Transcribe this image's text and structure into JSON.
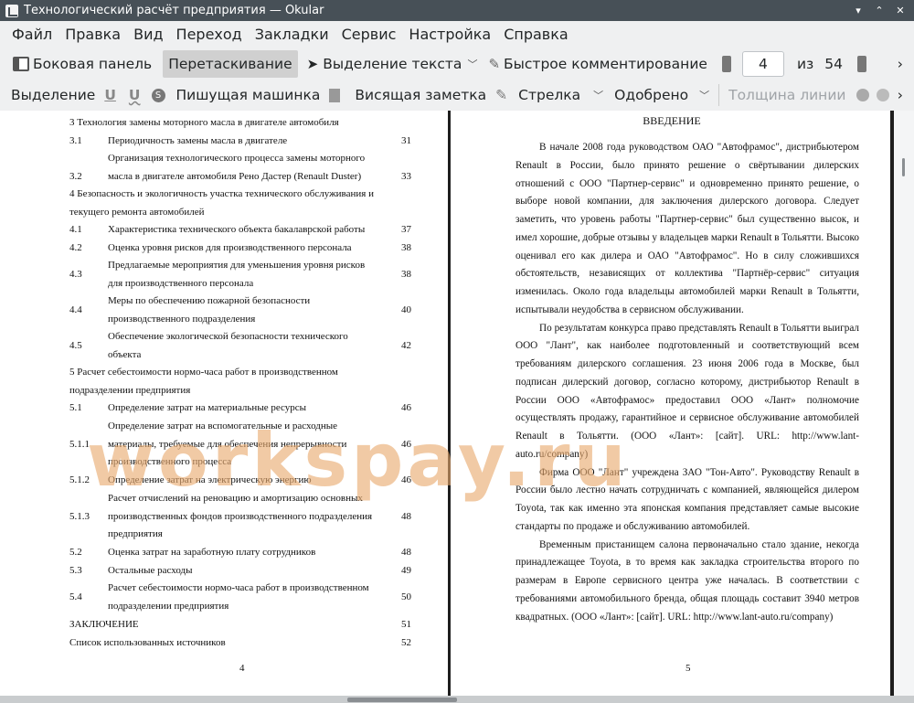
{
  "window": {
    "title": "Технологический расчёт предприятия  — Okular",
    "controls": [
      "▾",
      "⌃",
      "✕"
    ]
  },
  "menu": [
    "Файл",
    "Правка",
    "Вид",
    "Переход",
    "Закладки",
    "Сервис",
    "Настройка",
    "Справка"
  ],
  "toolbar1": {
    "sidebar": "Боковая панель",
    "drag": "Перетаскивание",
    "select_text": "Выделение текста",
    "quick_comment": "Быстрое комментирование",
    "page_current": "4",
    "page_of": "из",
    "page_total": "54",
    "more": "›"
  },
  "toolbar2": {
    "selection": "Выделение",
    "typewriter": "Пишущая машинка",
    "hanging_note": "Висящая заметка",
    "arrow": "Стрелка",
    "approved": "Одобрено",
    "line_width": "Толщина линии",
    "more": "›"
  },
  "left_page": {
    "page_number": "4",
    "entries": [
      {
        "n": "",
        "title": "3 Технология замены моторного масла в двигателе автомобиля",
        "p": ""
      },
      {
        "n": "3.1",
        "title": "Периодичность замены масла в двигателе",
        "p": "31"
      },
      {
        "n": "3.2",
        "title": "Организация технологического процесса замены моторного масла в двигателе автомобиля Рено Дастер (Renault Duster)",
        "p": "33"
      },
      {
        "n": "",
        "title": "4 Безопасность и экологичность участка технического обслуживания и текущего ремонта автомобилей",
        "p": ""
      },
      {
        "n": "4.1",
        "title": "Характеристика технического объекта бакалаврской работы",
        "p": "37"
      },
      {
        "n": "4.2",
        "title": "Оценка уровня рисков для производственного персонала",
        "p": "38"
      },
      {
        "n": "4.3",
        "title": "Предлагаемые мероприятия для уменьшения уровня рисков для производственного персонала",
        "p": "38"
      },
      {
        "n": "4.4",
        "title": "Меры по обеспечению пожарной безопасности производственного подразделения",
        "p": "40"
      },
      {
        "n": "4.5",
        "title": "Обеспечение экологической безопасности технического объекта",
        "p": "42"
      },
      {
        "n": "",
        "title": "5 Расчет себестоимости нормо-часа работ в производственном подразделении предприятия",
        "p": ""
      },
      {
        "n": "5.1",
        "title": "Определение затрат на материальные ресурсы",
        "p": "46"
      },
      {
        "n": "5.1.1",
        "title": "Определение затрат на вспомогательные и расходные материалы, требуемые для обеспечения непрерывности производственного процесса",
        "p": "46"
      },
      {
        "n": "5.1.2",
        "title": "Определение затрат на электрическую энергию",
        "p": "46"
      },
      {
        "n": "5.1.3",
        "title": "Расчет отчислений на реновацию и амортизацию основных производственных фондов производственного подразделения предприятия",
        "p": "48"
      },
      {
        "n": "5.2",
        "title": "Оценка затрат на заработную плату сотрудников",
        "p": "48"
      },
      {
        "n": "5.3",
        "title": "Остальные расходы",
        "p": "49"
      },
      {
        "n": "5.4",
        "title": "Расчет себестоимости нормо-часа работ в производственном подразделении предприятия",
        "p": "50"
      },
      {
        "n": "",
        "title": "ЗАКЛЮЧЕНИЕ",
        "p": "51"
      },
      {
        "n": "",
        "title": "Список использованных источников",
        "p": "52"
      }
    ]
  },
  "right_page": {
    "heading": "ВВЕДЕНИЕ",
    "page_number": "5",
    "paragraphs": [
      "В начале 2008 года руководством ОАО \"Автофрамос\", дистрибьютером Renault в России, было принято решение о свёртывании дилерских отношений с ООО \"Партнер-сервис\" и одновременно принято решение, о выборе новой компании, для заключения дилерского договора. Следует заметить, что уровень работы \"Партнер-сервис\" был существенно высок, и имел хорошие, добрые отзывы у владельцев марки Renault в Тольятти. Высоко оценивал его как дилера и ОАО \"Автофрамос\". Но в силу сложившихся обстоятельств, независящих от коллектива \"Партнёр-сервис\" ситуация изменилась. Около года владельцы автомобилей марки Renault в Тольятти, испытывали неудобства в сервисном обслуживании.",
      "По результатам конкурса право представлять Renault в Тольятти выиграл ООО \"Лант\", как наиболее подготовленный и соответствующий всем требованиям дилерского соглашения. 23 июня 2006 года в Москве, был подписан дилерский договор, согласно которому, дистрибьютор Renault в России ООО «Автофрамос» предоставил ООО «Лант» полномочие осуществлять продажу, гарантийное и сервисное обслуживание автомобилей Renault в Тольятти. (ООО «Лант»: [сайт]. URL: http://www.lant-auto.ru/company)",
      "Фирма ООО \"Лант\" учреждена ЗАО \"Тон-Авто\". Руководству Renault в России было лестно начать сотрудничать с компанией, являющейся дилером Toyota, так как именно эта японская компания представляет самые высокие стандарты по продаже и обслуживанию автомобилей.",
      "Временным пристанищем салона первоначально стало здание, некогда принадлежащее Toyota, в то время как закладка строительства второго по размерам в Европе сервисного центра уже началась. В соответствии с требованиями автомобильного бренда, общая площадь составит 3940 метров квадратных. (ООО «Лант»: [сайт]. URL: http://www.lant-auto.ru/company)"
    ]
  },
  "watermark": "workspay.ru",
  "colors": {
    "titlebar": "#475057",
    "watermark": "#e8aa6e",
    "active_button": "#d0d0d0"
  }
}
